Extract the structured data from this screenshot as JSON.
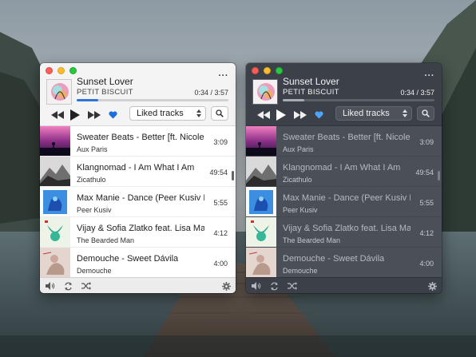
{
  "colors": {
    "accent_blue": "#2f73d8",
    "heart_light": "#1a6fe0",
    "heart_dark": "#4da3ff",
    "dark_window": "#3b4049",
    "dark_list": "#4b5058"
  },
  "now_playing": {
    "title": "Sunset Lover",
    "artist": "PETIT BISCUIT",
    "time": "0:34 / 3:57",
    "progress_fraction": 0.14
  },
  "controls": {
    "prev_icon": "rewind-icon",
    "play_icon": "play-icon",
    "next_icon": "fast-forward-icon",
    "like_icon": "heart-icon",
    "search_icon": "search-icon",
    "more_icon": "more-dots-icon"
  },
  "playlist_select": {
    "selected": "Liked tracks"
  },
  "tracks": [
    {
      "title": "Sweater Beats - Better [ft. Nicole...",
      "artist": "Aux Paris",
      "duration": "3:09"
    },
    {
      "title": "Klangnomad - I Am What I Am",
      "artist": "Zicathulo",
      "duration": "49:54"
    },
    {
      "title": "Max Manie - Dance (Peer Kusiv R...",
      "artist": "Peer Kusiv",
      "duration": "5:55"
    },
    {
      "title": "Vijay & Sofia Zlatko feat. Lisa Ma...",
      "artist": "The Bearded Man",
      "duration": "4:12"
    },
    {
      "title": "Demouche - Sweet Dávila",
      "artist": "Demouche",
      "duration": "4:00"
    }
  ],
  "bottom_bar": {
    "volume_icon": "volume-icon",
    "repeat_icon": "repeat-icon",
    "shuffle_icon": "shuffle-icon",
    "settings_icon": "gear-icon"
  }
}
